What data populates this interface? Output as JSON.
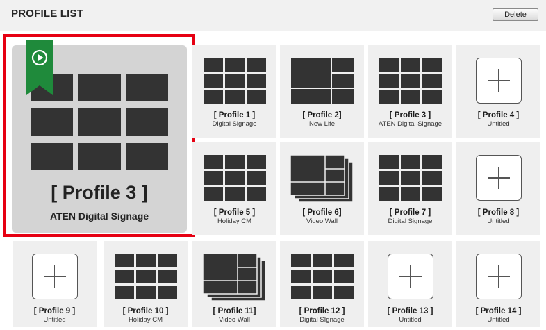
{
  "header": {
    "title": "PROFILE LIST",
    "delete_label": "Delete"
  },
  "featured": {
    "name": "[ Profile 3 ]",
    "subtitle": "ATEN Digital Signage",
    "icon": "play-icon"
  },
  "profiles": [
    {
      "name": "[ Profile 1 ]",
      "subtitle": "Digital Signage",
      "layout": "grid9"
    },
    {
      "name": "[ Profile 2]",
      "subtitle": "New Life",
      "layout": "split"
    },
    {
      "name": "[ Profile 3 ]",
      "subtitle": "ATEN Digital Signage",
      "layout": "grid9"
    },
    {
      "name": "[ Profile 4 ]",
      "subtitle": "Untitled",
      "layout": "add"
    },
    {
      "name": "[ Profile 5 ]",
      "subtitle": "Holiday CM",
      "layout": "grid9"
    },
    {
      "name": "[ Profile 6]",
      "subtitle": "Video Wall",
      "layout": "stack"
    },
    {
      "name": "[ Profile 7 ]",
      "subtitle": "Digital Signage",
      "layout": "grid9"
    },
    {
      "name": "[ Profile 8 ]",
      "subtitle": "Untitled",
      "layout": "add"
    },
    {
      "name": "[ Profile 9 ]",
      "subtitle": "Untitled",
      "layout": "add"
    },
    {
      "name": "[ Profile 10 ]",
      "subtitle": "Holiday CM",
      "layout": "grid9"
    },
    {
      "name": "[ Profile 11]",
      "subtitle": "Video Wall",
      "layout": "stack"
    },
    {
      "name": "[ Profile 12 ]",
      "subtitle": "Digital SIgnage",
      "layout": "grid9"
    },
    {
      "name": "[ Profile 13 ]",
      "subtitle": "Untitled",
      "layout": "add"
    },
    {
      "name": "[ Profile 14 ]",
      "subtitle": "Untitled",
      "layout": "add"
    }
  ],
  "colors": {
    "highlight": "#e60012",
    "bookmark": "#1f8a3b",
    "tile": "#333333",
    "card": "#efefef"
  }
}
